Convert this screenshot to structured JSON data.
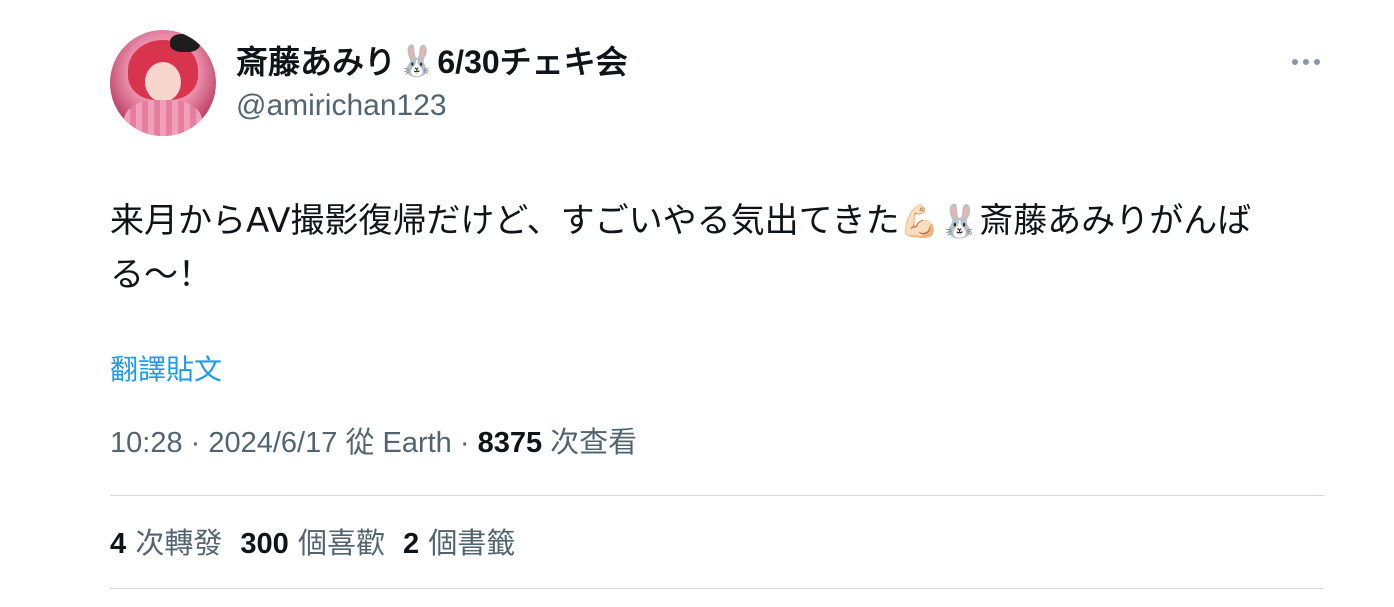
{
  "author": {
    "name_prefix": "斎藤あみり",
    "rabbit_emoji": "🐰",
    "name_suffix": "6/30チェキ会",
    "handle": "@amirichan123"
  },
  "tweet": {
    "text_part1": "来月からAV撮影復帰だけど、すごいやる気出てきた",
    "muscle_emoji": "💪🏻",
    "rabbit_emoji": "🐰",
    "text_part2": "斎藤あみりがんばる〜！"
  },
  "translate_label": "翻譯貼文",
  "meta": {
    "time": "10:28",
    "date": "2024/6/17",
    "source": "從 Earth",
    "separator": " · ",
    "views_count": "8375",
    "views_label": "次查看"
  },
  "stats": {
    "reposts_count": "4",
    "reposts_label": "次轉發",
    "likes_count": "300",
    "likes_label": "個喜歡",
    "bookmarks_count": "2",
    "bookmarks_label": "個書籤"
  },
  "icons": {
    "more": "more-horizontal-icon",
    "avatar": "avatar"
  },
  "colors": {
    "link": "#1d9bf0",
    "secondary_text": "#536471",
    "primary_text": "#0f1419",
    "divider": "#cfd9de"
  }
}
